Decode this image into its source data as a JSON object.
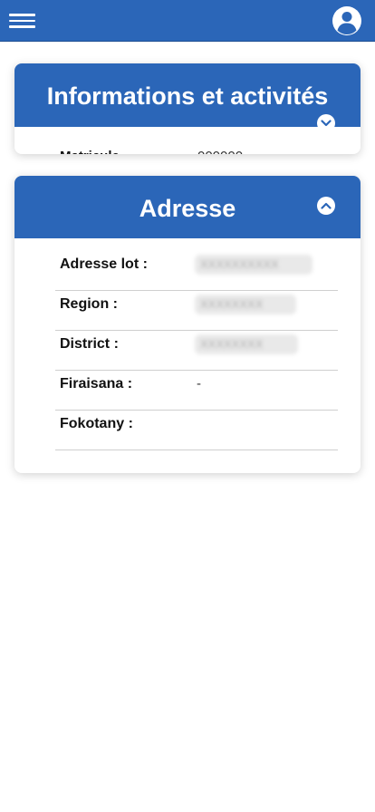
{
  "colors": {
    "primary": "#2b66b8",
    "background": "#ffffff"
  },
  "topbar": {
    "menu_icon": "hamburger-icon",
    "user_icon": "user-circle-icon"
  },
  "cards": {
    "info": {
      "title": "Informations et activités",
      "toggle_icon": "chevron-down-icon"
    },
    "adresse": {
      "title": "Adresse",
      "toggle_icon": "chevron-up-icon",
      "rows": [
        {
          "label": "Adresse lot :",
          "value_visible": false
        },
        {
          "label": "Region :",
          "value_visible": false
        },
        {
          "label": "District :",
          "value_visible": false
        },
        {
          "label": "Firaisana :",
          "value": "-"
        },
        {
          "label": "Fokotany :",
          "value": ""
        }
      ]
    }
  }
}
